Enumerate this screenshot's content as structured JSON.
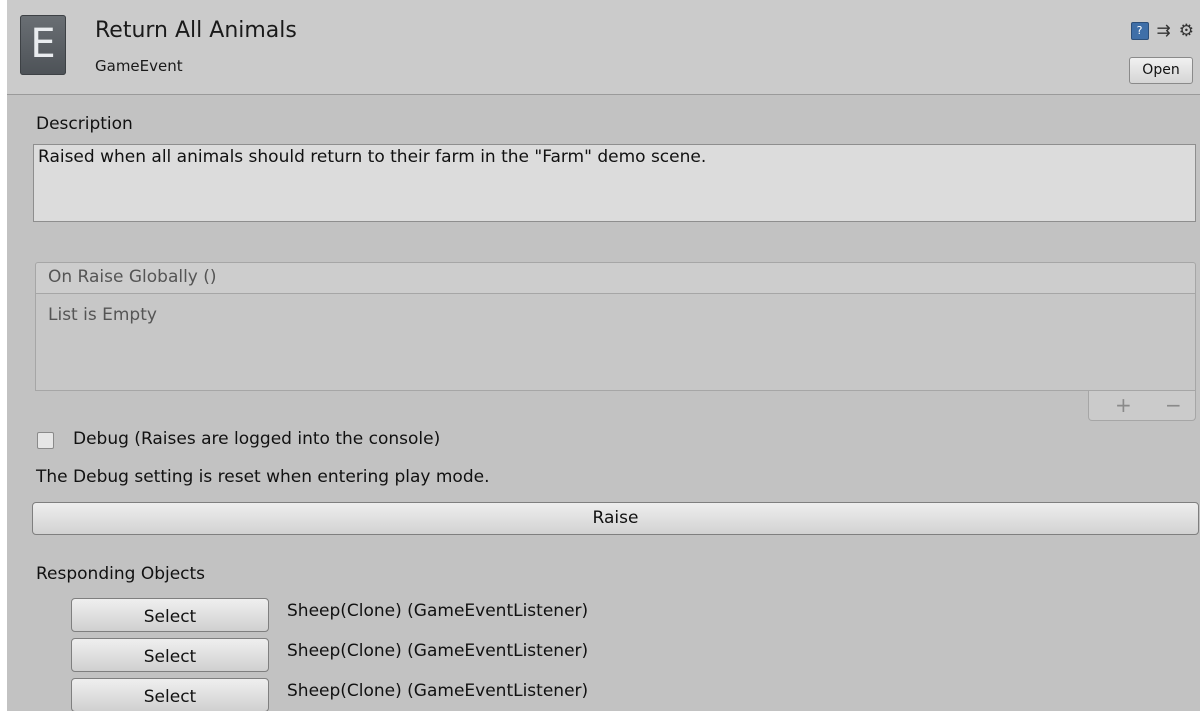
{
  "header": {
    "icon_letter": "E",
    "title": "Return All Animals",
    "subtitle": "GameEvent",
    "open_label": "Open",
    "icons": [
      "help-icon",
      "preset-icon",
      "gear-icon"
    ]
  },
  "description": {
    "label": "Description",
    "text": "Raised when all animals should return to their farm in the \"Farm\" demo scene."
  },
  "unity_event": {
    "header": "On Raise Globally ()",
    "empty_text": "List is Empty",
    "add_label": "+",
    "remove_label": "−"
  },
  "debug": {
    "checked": false,
    "label": "Debug (Raises are logged into the console)",
    "note": "The Debug setting is reset when entering play mode."
  },
  "raise_label": "Raise",
  "responding": {
    "label": "Responding Objects",
    "items": [
      {
        "button": "Select",
        "name": "Sheep(Clone) (GameEventListener)"
      },
      {
        "button": "Select",
        "name": "Sheep(Clone) (GameEventListener)"
      },
      {
        "button": "Select",
        "name": "Sheep(Clone) (GameEventListener)"
      }
    ]
  }
}
